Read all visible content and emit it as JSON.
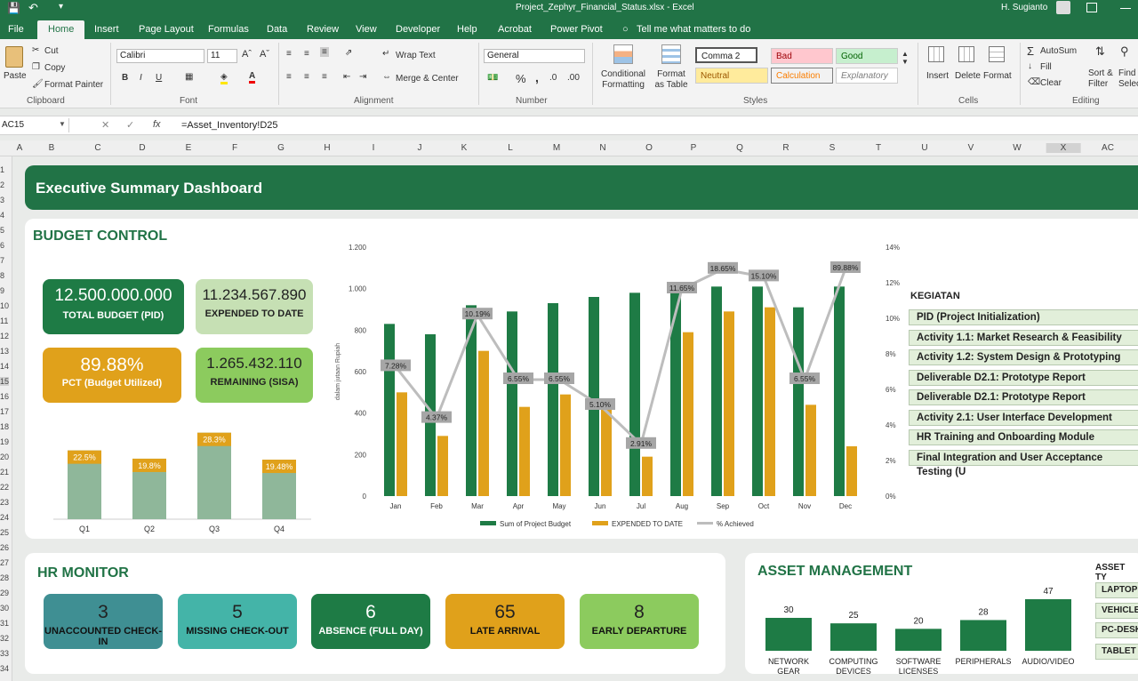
{
  "titlebar": {
    "filename": "Project_Zephyr_Financial_Status.xlsx",
    "app": "Excel",
    "user": "H. Sugianto"
  },
  "tabs": [
    "File",
    "Home",
    "Insert",
    "Page Layout",
    "Formulas",
    "Data",
    "Review",
    "View",
    "Developer",
    "Help",
    "Acrobat",
    "Power Pivot"
  ],
  "tell_me": "Tell me what matters to do",
  "ribbon": {
    "clipboard": {
      "paste": "Paste",
      "cut": "Cut",
      "copy": "Copy",
      "format_painter": "Format Painter",
      "label": "Clipboard"
    },
    "font": {
      "name": "Calibri",
      "size": "11",
      "label": "Font",
      "bold": "B",
      "italic": "I",
      "underline": "U"
    },
    "alignment": {
      "wrap": "Wrap Text",
      "merge": "Merge & Center",
      "label": "Alignment"
    },
    "number": {
      "format": "General",
      "label": "Number"
    },
    "styles": {
      "conditional": "Conditional Formatting",
      "format_table": "Format as Table",
      "comma2": "Comma 2",
      "bad": "Bad",
      "good": "Good",
      "neutral": "Neutral",
      "calculation": "Calculation",
      "explanatory": "Explanatory",
      "label": "Styles"
    },
    "cells": {
      "insert": "Insert",
      "delete": "Delete",
      "format": "Format",
      "label": "Cells"
    },
    "editing": {
      "autosum": "AutoSum",
      "fill": "Fill",
      "clear": "Clear",
      "sort": "Sort & Filter",
      "find": "Find & Select",
      "label": "Editing"
    }
  },
  "formula": {
    "namebox": "AC15",
    "fx": "fx",
    "value": "=Asset_Inventory!D25"
  },
  "columns": [
    "A",
    "B",
    "C",
    "D",
    "E",
    "F",
    "G",
    "H",
    "I",
    "J",
    "K",
    "L",
    "M",
    "N",
    "O",
    "P",
    "Q",
    "R",
    "S",
    "T",
    "U",
    "V",
    "W",
    "X",
    "AC"
  ],
  "rows": [
    "1",
    "2",
    "3",
    "4",
    "5",
    "6",
    "7",
    "8",
    "9",
    "10",
    "11",
    "12",
    "13",
    "14",
    "15",
    "16",
    "17",
    "18",
    "19",
    "20",
    "21",
    "22",
    "23",
    "24",
    "25",
    "26",
    "27",
    "28",
    "29",
    "30",
    "31",
    "32",
    "33",
    "34"
  ],
  "dashboard": {
    "title": "Executive Summary Dashboard"
  },
  "budget": {
    "title": "BUDGET CONTROL",
    "total_value": "12.500.000.000",
    "total_label": "TOTAL BUDGET (PID)",
    "expended_value": "11.234.567.890",
    "expended_label": "EXPENDED TO DATE",
    "pct_value": "89.88%",
    "pct_label": "PCT (Budget Utilized)",
    "remaining_value": "1.265.432.110",
    "remaining_label": "REMAINING (SISA)"
  },
  "chart_data": [
    {
      "type": "bar",
      "categories": [
        "Q1",
        "Q2",
        "Q3",
        "Q4"
      ],
      "values": [
        22.5,
        19.8,
        28.3,
        19.48
      ],
      "labels": [
        "22.5%",
        "19.8%",
        "28.3%",
        "19.48%"
      ],
      "ylim": [
        0,
        32
      ]
    },
    {
      "type": "bar",
      "categories": [
        "Jan",
        "Feb",
        "Mar",
        "Apr",
        "May",
        "Jun",
        "Jul",
        "Aug",
        "Sep",
        "Oct",
        "Nov",
        "Dec"
      ],
      "ylabel": "dalam jutaan Rupiah",
      "ylim": [
        0,
        1200
      ],
      "y2lim": [
        0,
        14
      ],
      "y_ticks": [
        "0",
        "200",
        "400",
        "600",
        "800",
        "1.000",
        "1.200"
      ],
      "y2_ticks": [
        "0%",
        "2%",
        "4%",
        "6%",
        "8%",
        "10%",
        "12%",
        "14%"
      ],
      "series": [
        {
          "name": "Sum of Project Budget",
          "values": [
            830,
            780,
            920,
            890,
            930,
            960,
            980,
            1010,
            1010,
            1010,
            910,
            1010
          ]
        },
        {
          "name": "EXPENDED TO DATE",
          "values": [
            500,
            290,
            700,
            430,
            490,
            430,
            190,
            790,
            890,
            910,
            440,
            240
          ]
        },
        {
          "name": "% Achieved",
          "axis": "secondary",
          "values": [
            7.28,
            4.37,
            10.19,
            6.55,
            6.55,
            5.1,
            2.91,
            11.65,
            18.65,
            15.1,
            6.55,
            89.88
          ],
          "labels": [
            "7.28%",
            "4.37%",
            "10.19%",
            "6.55%",
            "6.55%",
            "5.10%",
            "2.91%",
            "11.65%",
            "18.65%",
            "15.10%",
            "6.55%",
            "89.88%"
          ]
        }
      ],
      "legend": "bottom"
    },
    {
      "type": "bar",
      "categories": [
        "NETWORK GEAR",
        "COMPUTING DEVICES",
        "SOFTWARE LICENSES",
        "PERIPHERALS",
        "AUDIO/VIDEO"
      ],
      "values": [
        30,
        25,
        20,
        28,
        47
      ]
    }
  ],
  "kegiatan": {
    "header": "KEGIATAN",
    "items": [
      "PID (Project Initialization)",
      "Activity 1.1: Market Research & Feasibility",
      "Activity 1.2: System Design & Prototyping",
      "Deliverable D2.1: Prototype Report",
      "Deliverable D2.1: Prototype Report",
      "Activity 2.1: User Interface Development",
      "HR Training and Onboarding Module",
      "Final Integration and User Acceptance Testing (U"
    ]
  },
  "hr": {
    "title": "HR MONITOR",
    "items": [
      {
        "value": "3",
        "label": "UNACCOUNTED CHECK-IN"
      },
      {
        "value": "5",
        "label": "MISSING CHECK-OUT"
      },
      {
        "value": "6",
        "label": "ABSENCE (FULL DAY)"
      },
      {
        "value": "65",
        "label": "LATE ARRIVAL"
      },
      {
        "value": "8",
        "label": "EARLY DEPARTURE"
      }
    ]
  },
  "asset": {
    "title": "ASSET MANAGEMENT",
    "type_header": "ASSET TY",
    "types": [
      "LAPTOP",
      "VEHICLE",
      "PC-DESK",
      "TABLET"
    ]
  },
  "colors": {
    "green": "#217346",
    "dark_green": "#1e7b45",
    "light_green": "#c6e0b4",
    "gold": "#e0a11b",
    "teal": "#3f8f93",
    "lime": "#8ccb5e"
  }
}
